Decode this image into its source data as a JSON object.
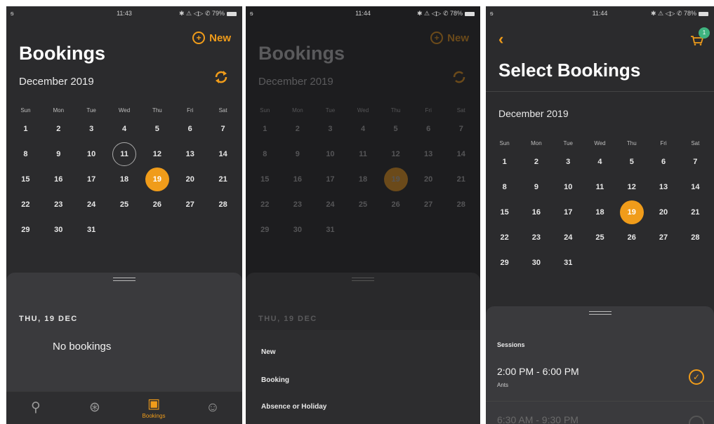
{
  "screen1": {
    "status": {
      "signal": "ᵴ",
      "time": "11:43",
      "right": "✱ ⚠ ◁▷ ✆ 79%"
    },
    "new_label": "New",
    "title": "Bookings",
    "month": "December 2019",
    "weekdays": [
      "Sun",
      "Mon",
      "Tue",
      "Wed",
      "Thu",
      "Fri",
      "Sat"
    ],
    "weeks": [
      [
        "1",
        "2",
        "3",
        "4",
        "5",
        "6",
        "7"
      ],
      [
        "8",
        "9",
        "10",
        "11",
        "12",
        "13",
        "14"
      ],
      [
        "15",
        "16",
        "17",
        "18",
        "19",
        "20",
        "21"
      ],
      [
        "22",
        "23",
        "24",
        "25",
        "26",
        "27",
        "28"
      ],
      [
        "29",
        "30",
        "31",
        "",
        "",
        "",
        ""
      ]
    ],
    "today": "11",
    "selected": "19",
    "sheet_date": "THU, 19 DEC",
    "empty_text": "No bookings",
    "tabs": [
      {
        "icon": "rocket-icon",
        "glyph": "⚲",
        "label": ""
      },
      {
        "icon": "activity-icon",
        "glyph": "⊛",
        "label": ""
      },
      {
        "icon": "calendar-icon",
        "glyph": "▣",
        "label": "Bookings"
      },
      {
        "icon": "profile-icon",
        "glyph": "☺",
        "label": ""
      }
    ]
  },
  "screen2": {
    "status": {
      "signal": "ᵴ",
      "time": "11:44",
      "right": "✱ ⚠ ◁▷ ✆ 78%"
    },
    "new_label": "New",
    "title": "Bookings",
    "month": "December 2019",
    "sheet_date": "THU, 19 DEC",
    "menu": [
      "New",
      "Booking",
      "Absence or Holiday"
    ]
  },
  "screen3": {
    "status": {
      "signal": "ᵴ",
      "time": "11:44",
      "right": "✱ ⚠ ◁▷ ✆ 78%"
    },
    "back": "‹",
    "cart_badge": "1",
    "title": "Select Bookings",
    "month": "December 2019",
    "sessions_label": "Sessions",
    "sessions": [
      {
        "time": "2:00 PM  -  6:00 PM",
        "sub": "Ants",
        "checked": true
      },
      {
        "time": "6:30 AM  -  9:30 PM",
        "sub": "",
        "checked": false
      }
    ]
  },
  "colors": {
    "accent": "#f09c1a",
    "badge": "#3fb37f"
  }
}
